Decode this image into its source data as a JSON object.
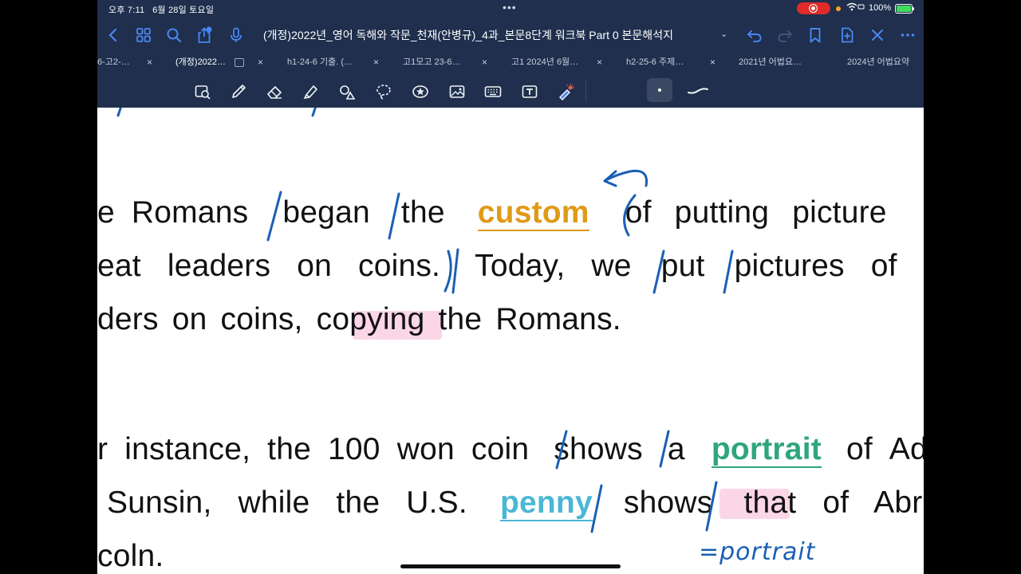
{
  "status": {
    "time": "오후 7:11",
    "date": "6월 28일 토요일",
    "battery": "100%"
  },
  "nav": {
    "title": "(개정)2022년_영어 독해와 작문_천재(안병규)_4과_본문8단계 워크북 Part 0 본문해석지"
  },
  "tabs": [
    {
      "label": "6-고2-…"
    },
    {
      "label": "(개정)2022…"
    },
    {
      "label": "h1-24-6 기출. (…"
    },
    {
      "label": "고1모고 23-6…"
    },
    {
      "label": "고1 2024년 6월…"
    },
    {
      "label": "h2-25-6 주제…"
    },
    {
      "label": "2021년 어법요…"
    },
    {
      "label": "2024년 어법요약"
    }
  ],
  "tools": [
    "zoom-lasso-icon",
    "pen-icon",
    "eraser-icon",
    "highlighter-icon",
    "shapes-icon",
    "lasso-icon",
    "sticker-icon",
    "image-icon",
    "keyboard-icon",
    "text-icon",
    "laser-pointer-icon"
  ],
  "document": {
    "p1": {
      "l1a": "e Romans",
      "l1b": "began",
      "l1c": "the",
      "l1d": "custom",
      "l1e": "of putting picture",
      "l2a": "eat leaders on coins.",
      "l2b": "Today, we",
      "l2c": "put",
      "l2d": "pictures of",
      "l3": "ders on coins, copying the Romans."
    },
    "p2": {
      "l1a": "r instance, the 100 won coin",
      "l1b": "shows",
      "l1c": "a",
      "l1d": "portrait",
      "l1e": "of Ad",
      "l2a": "Sunsin, while the U.S.",
      "l2b": "penny",
      "l2c": "shows",
      "l2d": "that of Abra",
      "l3": "coln."
    },
    "annotation": "=portrait"
  },
  "colors": {
    "toolbar_bg": "#1f2f4d",
    "accent": "#4a86f0",
    "ink": "#1a5fb4",
    "gold": "#e09a16",
    "green": "#2fa57e",
    "blue_highlight": "#4bb7d6",
    "pink_highlight": "#f7b4d2"
  }
}
